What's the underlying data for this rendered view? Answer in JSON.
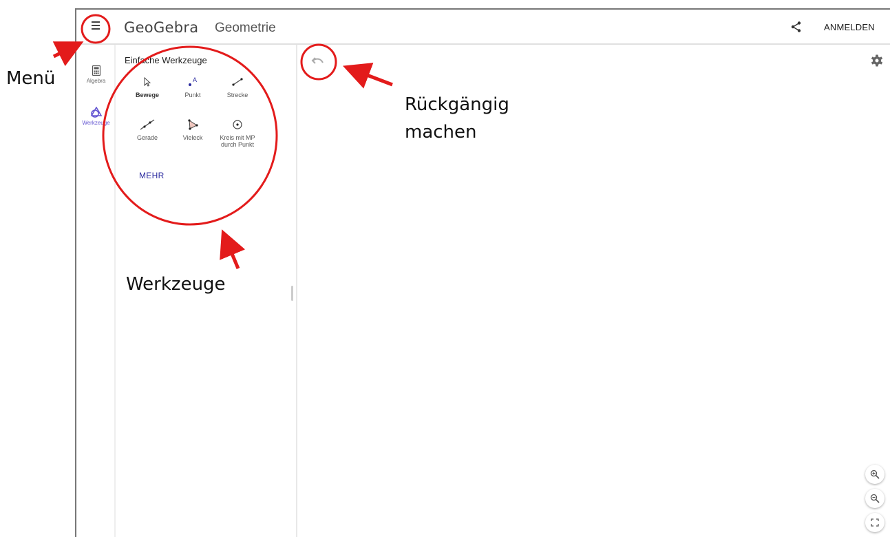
{
  "header": {
    "logo": "GeoGebra",
    "app_name": "Geometrie",
    "signin_label": "ANMELDEN"
  },
  "rail": {
    "items": [
      {
        "label": "Algebra",
        "icon": "calculator-icon"
      },
      {
        "label": "Werkzeuge",
        "icon": "tools-icon"
      }
    ]
  },
  "tools": {
    "title": "Einfache Werkzeuge",
    "items": [
      {
        "label": "Bewege",
        "icon": "move-icon"
      },
      {
        "label": "Punkt",
        "icon": "point-icon"
      },
      {
        "label": "Strecke",
        "icon": "segment-icon"
      },
      {
        "label": "Gerade",
        "icon": "line-icon"
      },
      {
        "label": "Vieleck",
        "icon": "polygon-icon"
      },
      {
        "label": "Kreis mit MP durch Punkt",
        "icon": "circle-icon"
      }
    ],
    "more_label": "MEHR"
  },
  "annotations": {
    "menu": "Menü",
    "undo_line1": "Rückgängig",
    "undo_line2": "machen",
    "tools": "Werkzeuge"
  },
  "colors": {
    "accent": "#6557d2",
    "annotation": "#e31b1b",
    "more_link": "#2c2ca0"
  }
}
